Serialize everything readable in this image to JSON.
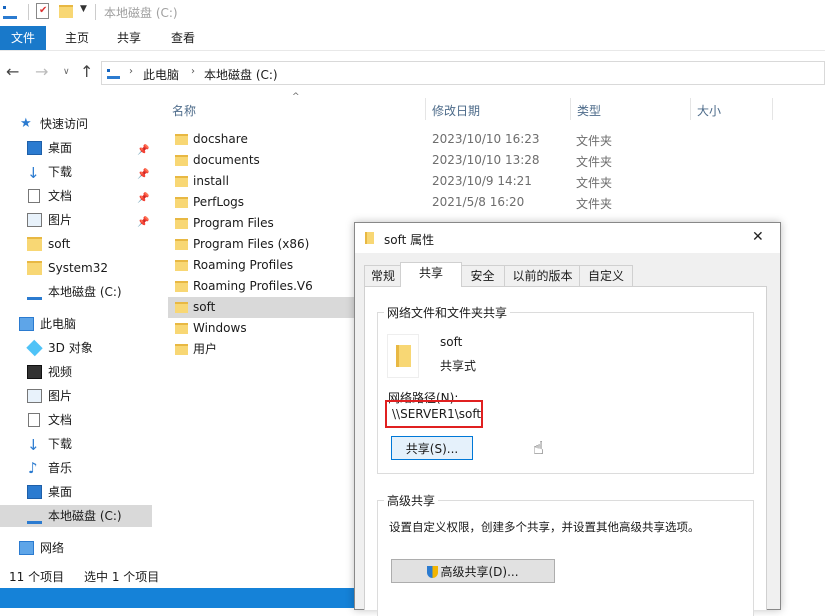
{
  "window": {
    "title": "本地磁盘 (C:)"
  },
  "ribbon": {
    "tabs": [
      "文件",
      "主页",
      "共享",
      "查看"
    ]
  },
  "address": {
    "crumbs": [
      "此电脑",
      "本地磁盘 (C:)"
    ]
  },
  "sidebar": {
    "quick_access": "快速访问",
    "quick_items": [
      "桌面",
      "下载",
      "文档",
      "图片",
      "soft",
      "System32",
      "本地磁盘 (C:)"
    ],
    "this_pc": "此电脑",
    "pc_items": [
      "3D 对象",
      "视频",
      "图片",
      "文档",
      "下载",
      "音乐",
      "桌面",
      "本地磁盘 (C:)"
    ],
    "network": "网络"
  },
  "filelist": {
    "columns": {
      "name": "名称",
      "date": "修改日期",
      "type": "类型",
      "size": "大小"
    },
    "rows": [
      {
        "name": "docshare",
        "date": "2023/10/10 16:23",
        "type": "文件夹"
      },
      {
        "name": "documents",
        "date": "2023/10/10 13:28",
        "type": "文件夹"
      },
      {
        "name": "install",
        "date": "2023/10/9 14:21",
        "type": "文件夹"
      },
      {
        "name": "PerfLogs",
        "date": "2021/5/8 16:20",
        "type": "文件夹"
      },
      {
        "name": "Program Files",
        "date": "",
        "type": ""
      },
      {
        "name": "Program Files (x86)",
        "date": "",
        "type": ""
      },
      {
        "name": "Roaming Profiles",
        "date": "",
        "type": ""
      },
      {
        "name": "Roaming Profiles.V6",
        "date": "",
        "type": ""
      },
      {
        "name": "soft",
        "date": "",
        "type": ""
      },
      {
        "name": "Windows",
        "date": "",
        "type": ""
      },
      {
        "name": "用户",
        "date": "",
        "type": ""
      }
    ]
  },
  "status": {
    "count": "11 个项目",
    "selected": "选中 1 个项目"
  },
  "dialog": {
    "title": "soft 属性",
    "close": "✕",
    "tabs": [
      "常规",
      "共享",
      "安全",
      "以前的版本",
      "自定义"
    ],
    "group1_title": "网络文件和文件夹共享",
    "folder_name": "soft",
    "share_state": "共享式",
    "net_path_label": "网络路径(N):",
    "net_path": "\\\\SERVER1\\soft",
    "share_button": "共享(S)...",
    "group2_title": "高级共享",
    "adv_desc": "设置自定义权限，创建多个共享，并设置其他高级共享选项。",
    "adv_button": "高级共享(D)..."
  }
}
